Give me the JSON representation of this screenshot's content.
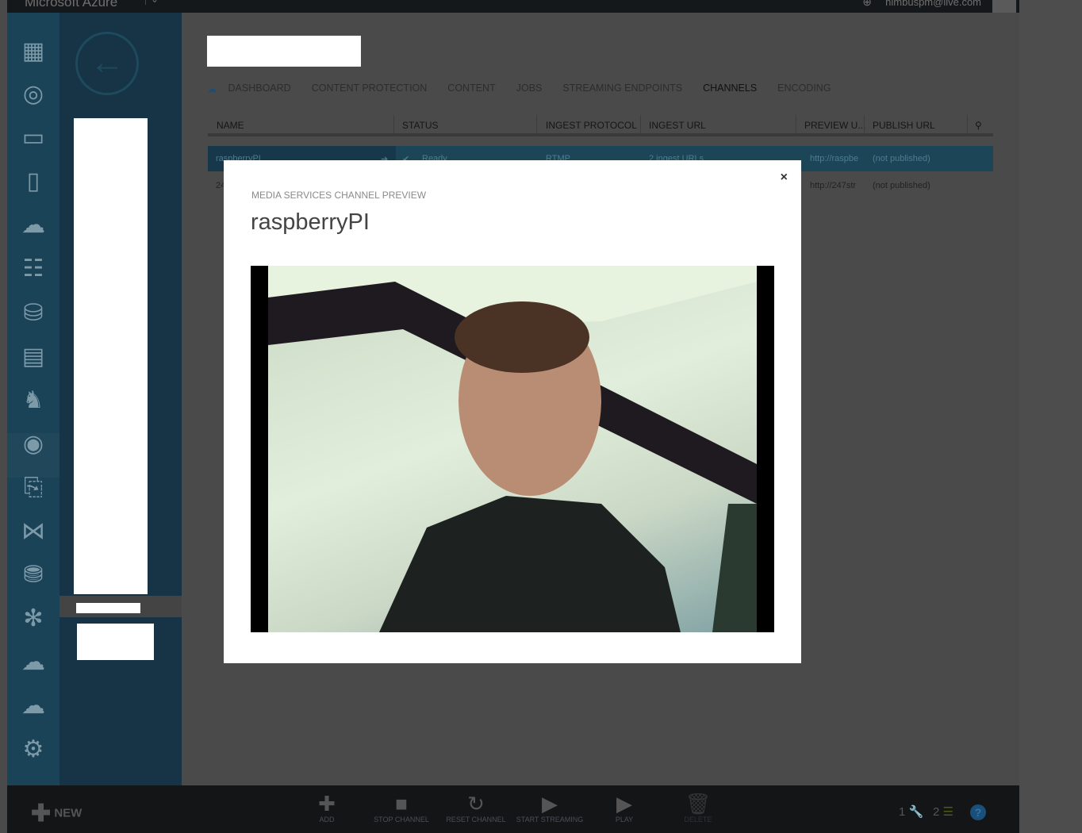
{
  "topbar": {
    "brand": "Microsoft Azure",
    "user_email": "nimbuspm@live.com"
  },
  "tabs": [
    {
      "label": "DASHBOARD"
    },
    {
      "label": "CONTENT PROTECTION"
    },
    {
      "label": "CONTENT"
    },
    {
      "label": "JOBS"
    },
    {
      "label": "STREAMING ENDPOINTS"
    },
    {
      "label": "CHANNELS",
      "active": true
    },
    {
      "label": "ENCODING"
    }
  ],
  "table": {
    "columns": [
      "NAME",
      "STATUS",
      "INGEST PROTOCOL",
      "INGEST URL",
      "PREVIEW U...",
      "PUBLISH URL"
    ],
    "rows": [
      {
        "name": "raspberryPI",
        "status": "Ready",
        "protocol": "RTMP",
        "ingest_url": "2 ingest URLs",
        "preview_url": "http://raspbe",
        "publish_url": "(not published)",
        "selected": true
      },
      {
        "name": "24",
        "preview_url": "http://247str",
        "publish_url": "(not published)"
      }
    ]
  },
  "modal": {
    "kicker": "MEDIA SERVICES CHANNEL PREVIEW",
    "title": "raspberryPI",
    "close": "×"
  },
  "bottombar": {
    "new_label": "NEW",
    "actions": [
      {
        "label": "ADD",
        "icon": "plus-icon"
      },
      {
        "label": "STOP CHANNEL",
        "icon": "stop-icon"
      },
      {
        "label": "RESET CHANNEL",
        "icon": "reset-icon"
      },
      {
        "label": "START STREAMING",
        "icon": "play-icon"
      },
      {
        "label": "PLAY",
        "icon": "play-icon"
      },
      {
        "label": "DELETE",
        "icon": "trash-icon",
        "disabled": true
      }
    ],
    "status": {
      "operations": "1",
      "notifications": "2"
    },
    "help": "?"
  },
  "colors": {
    "nav": "#1b4358",
    "selected_row": "#1c4658",
    "accent": "#1a4f7a"
  }
}
